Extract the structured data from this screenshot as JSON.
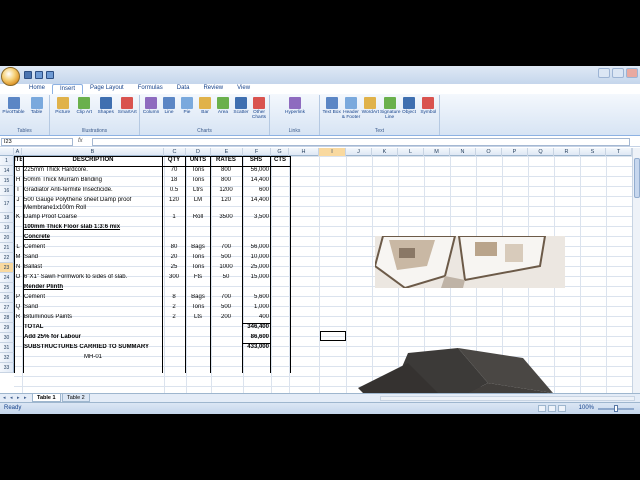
{
  "ribbon": {
    "tabs": [
      "Home",
      "Insert",
      "Page Layout",
      "Formulas",
      "Data",
      "Review",
      "View"
    ],
    "active_tab": "Insert",
    "groups": [
      {
        "label": "Tables",
        "buttons": [
          "PivotTable",
          "Table"
        ]
      },
      {
        "label": "Illustrations",
        "buttons": [
          "Picture",
          "Clip Art",
          "Shapes",
          "SmartArt"
        ]
      },
      {
        "label": "Charts",
        "buttons": [
          "Column",
          "Line",
          "Pie",
          "Bar",
          "Area",
          "Scatter",
          "Other Charts"
        ]
      },
      {
        "label": "Links",
        "buttons": [
          "Hyperlink"
        ]
      },
      {
        "label": "Text",
        "buttons": [
          "Text Box",
          "Header & Footer",
          "WordArt",
          "Signature Line",
          "Object",
          "Symbol"
        ]
      }
    ]
  },
  "formula_bar": {
    "name_box": "I23",
    "fx": "fx",
    "value": ""
  },
  "columns": [
    "A",
    "B",
    "C",
    "D",
    "E",
    "F",
    "G",
    "H",
    "I",
    "J",
    "K",
    "L",
    "M",
    "N",
    "O",
    "P",
    "Q",
    "R",
    "S",
    "T"
  ],
  "selected_column": "I",
  "row_numbers": [
    "1",
    "14",
    "15",
    "16",
    "17",
    "18",
    "19",
    "20",
    "21",
    "22",
    "23",
    "24",
    "25",
    "26",
    "27",
    "28",
    "29",
    "30",
    "31",
    "32",
    "33"
  ],
  "selected_row": "23",
  "header_row": {
    "item": "ITEM",
    "description": "DESCRIPTION",
    "qty": "QTY",
    "units": "UNTS",
    "rates": "RATES",
    "shs": "SHS",
    "cts": "CTS"
  },
  "rows": [
    {
      "item": "G",
      "description": "225mm Thick Hardcore.",
      "qty": "70",
      "units": "Tons",
      "rates": "800",
      "shs": "56,000"
    },
    {
      "item": "H",
      "description": "50mm Thick Murram Blinding",
      "qty": "18",
      "units": "Tons",
      "rates": "800",
      "shs": "14,400"
    },
    {
      "item": "I",
      "description": "Gradiator Anti-termite Insecticide.",
      "qty": "0.5",
      "units": "Ltrs",
      "rates": "1200",
      "shs": "600"
    },
    {
      "item": "J",
      "description": "500 Gauge Polythene sheet Damp proof Membrane1x100m Roll",
      "qty": "120",
      "units": "LM",
      "rates": "120",
      "shs": "14,400"
    },
    {
      "item": "K",
      "description": "Damp Proof Coarse",
      "qty": "1",
      "units": "Roll",
      "rates": "3500",
      "shs": "3,500"
    },
    {
      "item": "",
      "description": "100mm Thick Floor slab 1:3:6 mix",
      "qty": "",
      "units": "",
      "rates": "",
      "shs": "",
      "style": "uheading"
    },
    {
      "item": "",
      "description": "Concrete",
      "qty": "",
      "units": "",
      "rates": "",
      "shs": "",
      "style": "uheading"
    },
    {
      "item": "L",
      "description": "Cement",
      "qty": "80",
      "units": "Bags",
      "rates": "700",
      "shs": "56,000"
    },
    {
      "item": "M",
      "description": "Sand",
      "qty": "20",
      "units": "Tons",
      "rates": "500",
      "shs": "10,000"
    },
    {
      "item": "N",
      "description": "Ballast",
      "qty": "25",
      "units": "Tons",
      "rates": "1000",
      "shs": "25,000"
    },
    {
      "item": "O",
      "description": "6\"X1\" Sawn Formwork to sides of slab.",
      "qty": "300",
      "units": "Fts",
      "rates": "50",
      "shs": "15,000"
    },
    {
      "item": "",
      "description": "Render Plinth",
      "qty": "",
      "units": "",
      "rates": "",
      "shs": "",
      "style": "uheading"
    },
    {
      "item": "P",
      "description": "Cement",
      "qty": "8",
      "units": "Bags",
      "rates": "700",
      "shs": "5,600"
    },
    {
      "item": "Q",
      "description": "Sand",
      "qty": "2",
      "units": "Tons",
      "rates": "500",
      "shs": "1,000"
    },
    {
      "item": "R",
      "description": "Bituminous Paints",
      "qty": "2",
      "units": "Lts",
      "rates": "200",
      "shs": "400"
    },
    {
      "item": "",
      "description": "TOTAL",
      "qty": "",
      "units": "",
      "rates": "",
      "shs": "346,400",
      "style": "bold"
    },
    {
      "item": "",
      "description": "Add 25% for Labour",
      "qty": "",
      "units": "",
      "rates": "",
      "shs": "86,600",
      "style": "bold"
    },
    {
      "item": "",
      "description": "SUBSTRUCTURES CARRIED TO SUMMARY",
      "qty": "",
      "units": "",
      "rates": "",
      "shs": "433,000",
      "style": "bold"
    },
    {
      "item": "",
      "description": "MH-01",
      "qty": "",
      "units": "",
      "rates": "",
      "shs": "",
      "style": "center"
    }
  ],
  "sheet_tabs": [
    "Table 1",
    "Table 2"
  ],
  "active_sheet": "Table 1",
  "status": {
    "text": "Ready",
    "zoom": "100%"
  },
  "images": [
    {
      "name": "floor-plan-3d-render"
    },
    {
      "name": "house-3d-render"
    }
  ]
}
